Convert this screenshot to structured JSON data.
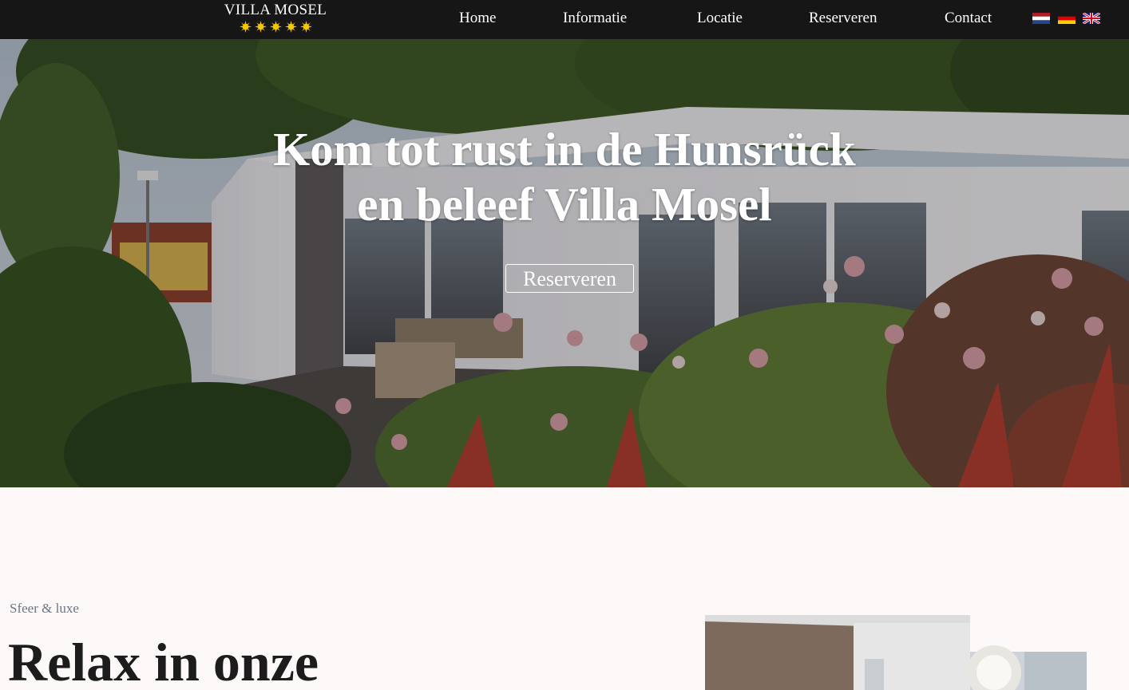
{
  "nav": {
    "logo_text": "VILLA MOSEL",
    "stars": 5,
    "items": [
      {
        "label": "Home"
      },
      {
        "label": "Informatie"
      },
      {
        "label": "Locatie"
      },
      {
        "label": "Reserveren"
      },
      {
        "label": "Contact"
      }
    ],
    "languages": [
      "nl-flag-icon",
      "de-flag-icon",
      "en-flag-icon"
    ]
  },
  "hero": {
    "title_line1": "Kom tot rust in de Hunsrück",
    "title_line2": "en beleef Villa Mosel",
    "cta_label": "Reserveren"
  },
  "section": {
    "eyebrow": "Sfeer & luxe",
    "heading": "Relax in onze"
  },
  "colors": {
    "nav_bg": "#161616",
    "star": "#f5c800",
    "page_bg": "#fdf9f8",
    "eyebrow": "#6b7588"
  }
}
